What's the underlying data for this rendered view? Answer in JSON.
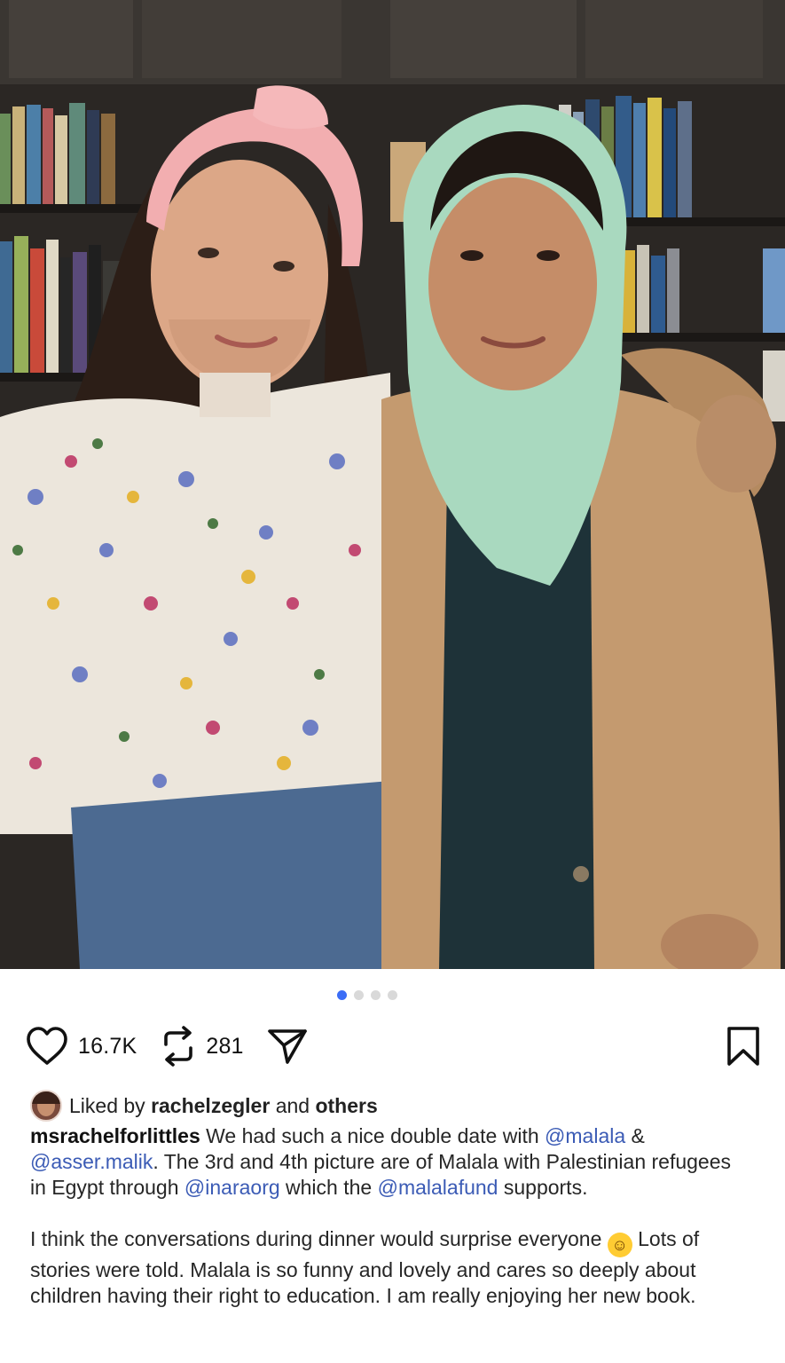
{
  "carousel": {
    "total": 4,
    "active_index": 0
  },
  "actions": {
    "like_icon": "heart-icon",
    "likes_count": "16.7K",
    "repost_icon": "repost-icon",
    "reposts_count": "281",
    "share_icon": "send-icon",
    "save_icon": "bookmark-icon"
  },
  "liked_by": {
    "prefix": "Liked by",
    "user": "rachelzegler",
    "and": "and",
    "others": "others"
  },
  "caption": {
    "username": "msrachelforlittles",
    "t1": " We had such a nice double date with ",
    "m1": "@malala",
    "t2": " & ",
    "m2": "@asser.malik",
    "t3": ". The 3rd and 4th picture are of Malala with Palestinian refugees in Egypt through ",
    "m3": "@inaraorg",
    "t4": " which the ",
    "m4": "@malalafund",
    "t5": " supports.",
    "p2a": "I think the conversations during dinner would surprise everyone ",
    "emoji": "🤣",
    "p2b": " Lots of stories were told. Malala is so funny and lovely and cares so deeply about children having their right to education. I am really enjoying her new book."
  },
  "colors": {
    "accent": "#3b6df6",
    "mention": "#3b5bb5"
  }
}
